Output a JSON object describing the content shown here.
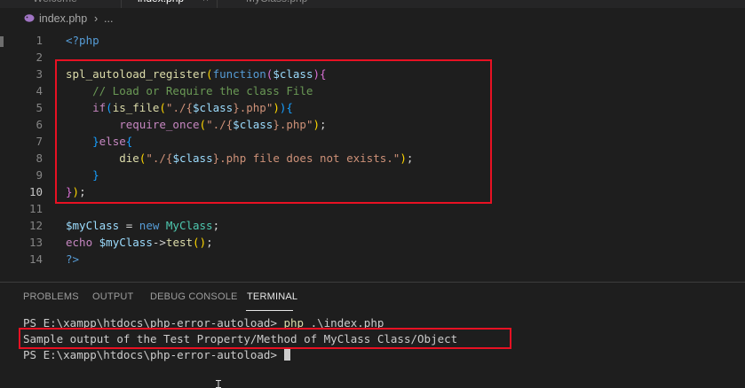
{
  "tabs": [
    {
      "label": "Welcome",
      "active": false
    },
    {
      "label": "index.php",
      "active": true
    },
    {
      "label": "MyClass.php",
      "active": false
    }
  ],
  "tab_close_glyph": "×",
  "breadcrumb": {
    "file": "index.php",
    "separator": "›",
    "more": "..."
  },
  "editor": {
    "current_line": "10",
    "lines": [
      {
        "n": "1",
        "tokens": [
          [
            "<?php",
            "php"
          ]
        ]
      },
      {
        "n": "2",
        "tokens": []
      },
      {
        "n": "3",
        "tokens": [
          [
            "spl_autoload_register",
            "fn"
          ],
          [
            "(",
            "p1"
          ],
          [
            "function",
            "kw"
          ],
          [
            "(",
            "p2"
          ],
          [
            "$class",
            "var"
          ],
          [
            ")",
            "p2"
          ],
          [
            "{",
            "p2"
          ]
        ]
      },
      {
        "n": "4",
        "tokens": [
          [
            "    ",
            "def"
          ],
          [
            "// Load or Require the class File",
            "cmt"
          ]
        ]
      },
      {
        "n": "5",
        "tokens": [
          [
            "    ",
            "def"
          ],
          [
            "if",
            "ctl"
          ],
          [
            "(",
            "p3"
          ],
          [
            "is_file",
            "fn"
          ],
          [
            "(",
            "p1"
          ],
          [
            "\"./{",
            "str"
          ],
          [
            "$class",
            "var"
          ],
          [
            "}.php\"",
            "str"
          ],
          [
            ")",
            "p1"
          ],
          [
            ")",
            "p3"
          ],
          [
            "{",
            "p3"
          ]
        ]
      },
      {
        "n": "6",
        "tokens": [
          [
            "        ",
            "def"
          ],
          [
            "require_once",
            "ctl"
          ],
          [
            "(",
            "p1"
          ],
          [
            "\"./{",
            "str"
          ],
          [
            "$class",
            "var"
          ],
          [
            "}.php\"",
            "str"
          ],
          [
            ")",
            "p1"
          ],
          [
            ";",
            "def"
          ]
        ]
      },
      {
        "n": "7",
        "tokens": [
          [
            "    ",
            "def"
          ],
          [
            "}",
            "p3"
          ],
          [
            "else",
            "ctl"
          ],
          [
            "{",
            "p3"
          ]
        ]
      },
      {
        "n": "8",
        "tokens": [
          [
            "        ",
            "def"
          ],
          [
            "die",
            "fn"
          ],
          [
            "(",
            "p1"
          ],
          [
            "\"./{",
            "str"
          ],
          [
            "$class",
            "var"
          ],
          [
            "}.php file does not exists.\"",
            "str"
          ],
          [
            ")",
            "p1"
          ],
          [
            ";",
            "def"
          ]
        ]
      },
      {
        "n": "9",
        "tokens": [
          [
            "    ",
            "def"
          ],
          [
            "}",
            "p3"
          ]
        ]
      },
      {
        "n": "10",
        "tokens": [
          [
            "}",
            "p2"
          ],
          [
            ")",
            "p1"
          ],
          [
            ";",
            "def"
          ]
        ]
      },
      {
        "n": "11",
        "tokens": []
      },
      {
        "n": "12",
        "tokens": [
          [
            "$myClass",
            "var"
          ],
          [
            " = ",
            "def"
          ],
          [
            "new",
            "kw"
          ],
          [
            " ",
            "def"
          ],
          [
            "MyClass",
            "cls"
          ],
          [
            ";",
            "def"
          ]
        ]
      },
      {
        "n": "13",
        "tokens": [
          [
            "echo",
            "ctl"
          ],
          [
            " ",
            "def"
          ],
          [
            "$myClass",
            "var"
          ],
          [
            "->",
            "def"
          ],
          [
            "test",
            "fn"
          ],
          [
            "(",
            "p1"
          ],
          [
            ")",
            "p1"
          ],
          [
            ";",
            "def"
          ]
        ]
      },
      {
        "n": "14",
        "tokens": [
          [
            "?>",
            "php"
          ]
        ]
      }
    ]
  },
  "panel": {
    "tabs": [
      {
        "label": "PROBLEMS",
        "active": false
      },
      {
        "label": "OUTPUT",
        "active": false
      },
      {
        "label": "DEBUG CONSOLE",
        "active": false
      },
      {
        "label": "TERMINAL",
        "active": true
      }
    ],
    "terminal": {
      "line1_prompt": "PS E:\\xampp\\htdocs\\php-error-autoload> ",
      "line1_cmd": "php",
      "line1_args": " .\\index.php",
      "line2_output": "Sample output of the Test Property/Method of MyClass Class/Object",
      "line3_prompt": "PS E:\\xampp\\htdocs\\php-error-autoload> "
    }
  },
  "colors": {
    "highlight_border": "#e81123",
    "editor_bg": "#1e1e1e",
    "string": "#ce9178",
    "variable": "#9cdcfe",
    "function": "#dcdcaa",
    "comment": "#6a9955"
  }
}
